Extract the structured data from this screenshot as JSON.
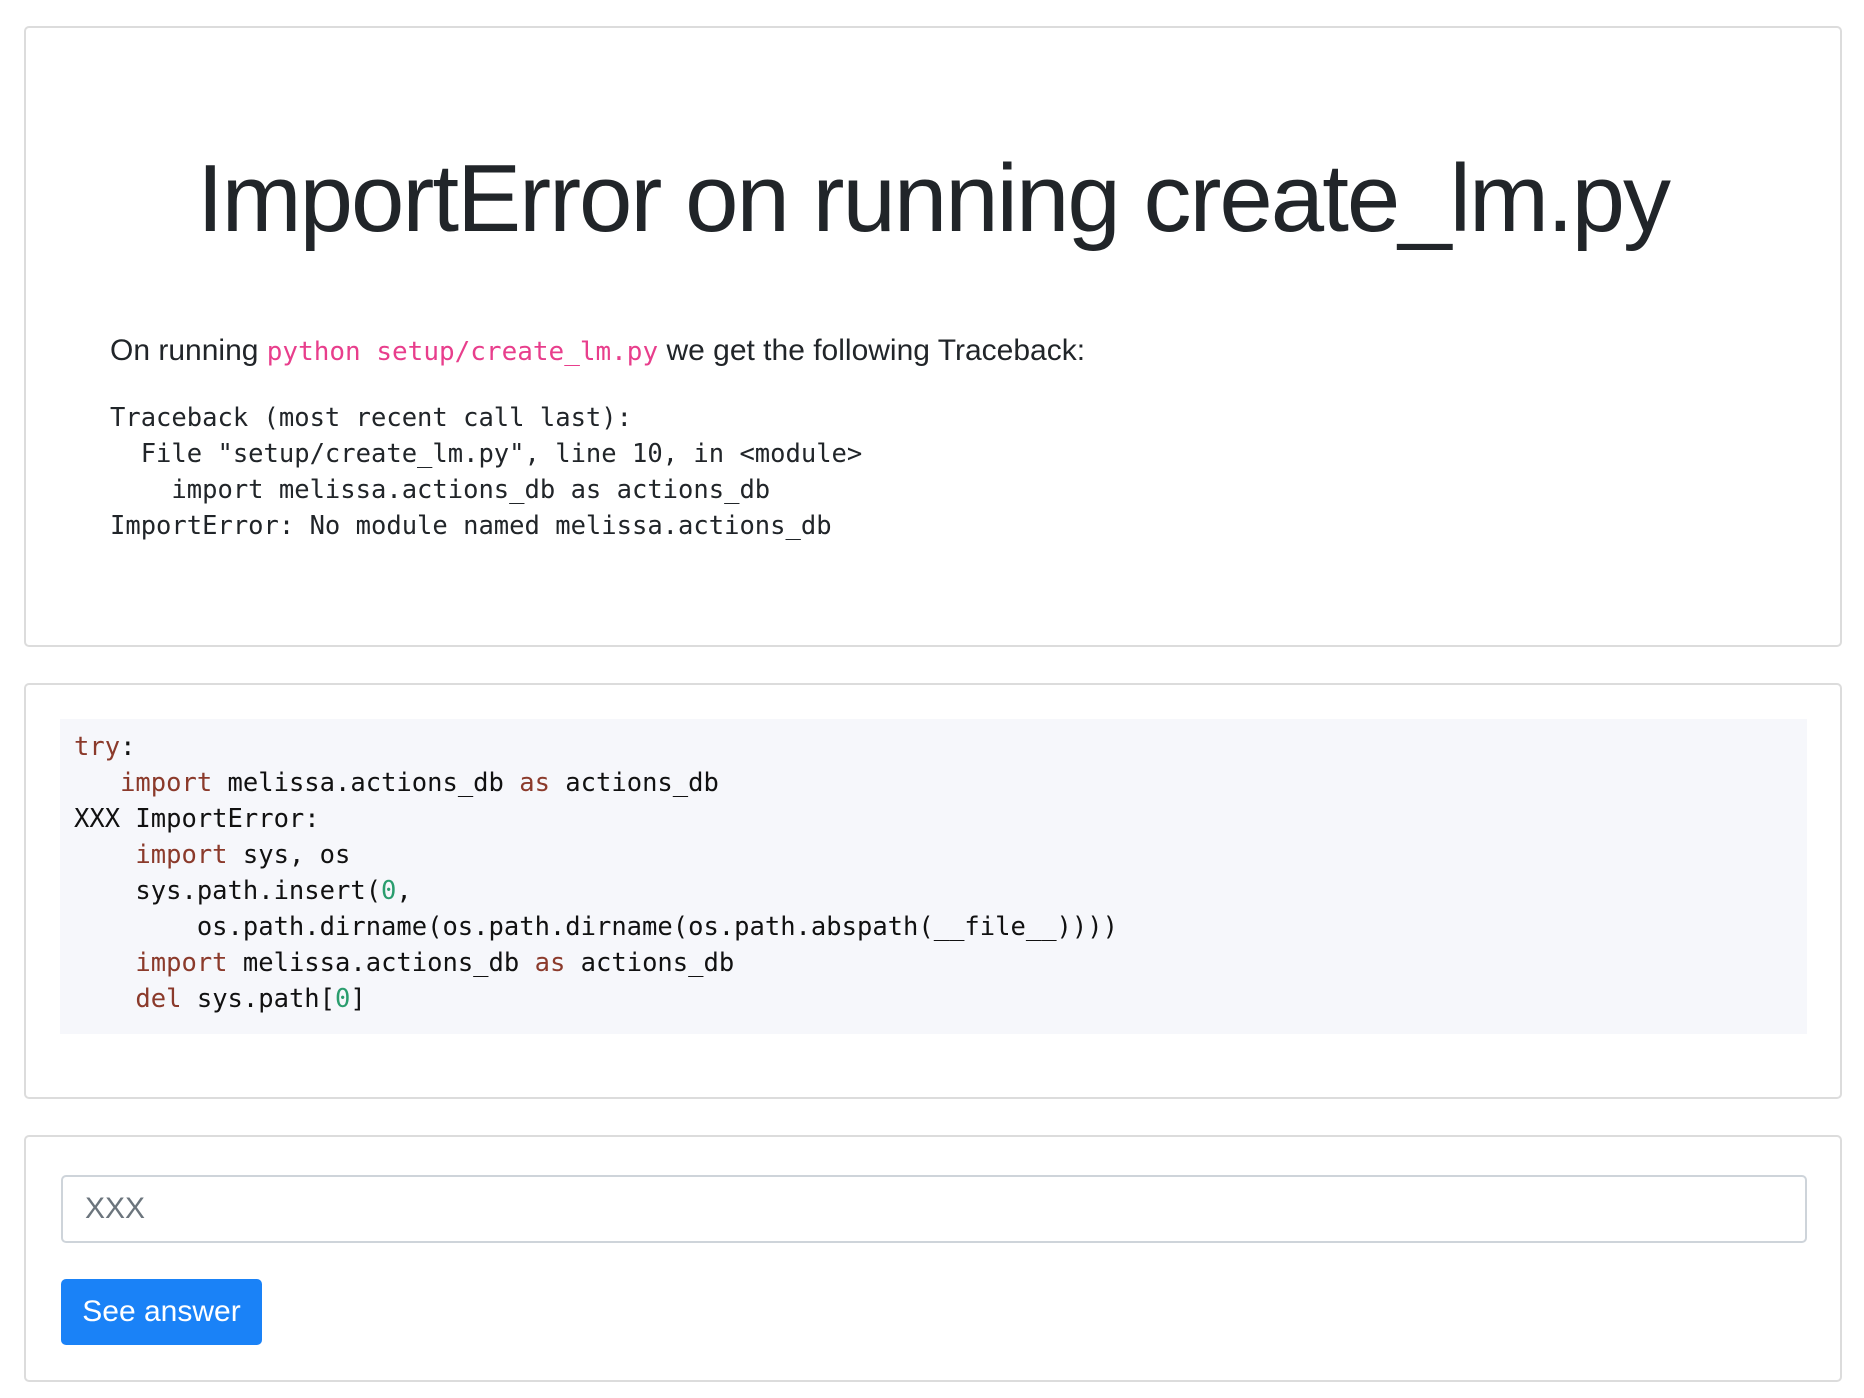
{
  "question": {
    "title": "ImportError on running create_lm.py",
    "intro_before": "On running ",
    "intro_code": "python setup/create_lm.py",
    "intro_after": " we get the following Traceback:",
    "traceback": [
      "Traceback (most recent call last):",
      "  File \"setup/create_lm.py\", line 10, in <module>",
      "    import melissa.actions_db as actions_db",
      "ImportError: No module named melissa.actions_db"
    ]
  },
  "code": {
    "lines": [
      [
        {
          "t": "try",
          "c": "kw"
        },
        {
          "t": ":",
          "c": ""
        }
      ],
      [
        {
          "t": "   ",
          "c": ""
        },
        {
          "t": "import",
          "c": "kw"
        },
        {
          "t": " melissa.actions_db ",
          "c": ""
        },
        {
          "t": "as",
          "c": "kw"
        },
        {
          "t": " actions_db",
          "c": ""
        }
      ],
      [
        {
          "t": "XXX ImportError:",
          "c": ""
        }
      ],
      [
        {
          "t": "    ",
          "c": ""
        },
        {
          "t": "import",
          "c": "kw"
        },
        {
          "t": " sys, os",
          "c": ""
        }
      ],
      [
        {
          "t": "    sys.path.insert(",
          "c": ""
        },
        {
          "t": "0",
          "c": "num"
        },
        {
          "t": ",",
          "c": ""
        }
      ],
      [
        {
          "t": "        os.path.dirname(os.path.dirname(os.path.abspath(__file__))))",
          "c": ""
        }
      ],
      [
        {
          "t": "    ",
          "c": ""
        },
        {
          "t": "import",
          "c": "kw"
        },
        {
          "t": " melissa.actions_db ",
          "c": ""
        },
        {
          "t": "as",
          "c": "kw"
        },
        {
          "t": " actions_db",
          "c": ""
        }
      ],
      [
        {
          "t": "    ",
          "c": ""
        },
        {
          "t": "del",
          "c": "kw"
        },
        {
          "t": " sys.path[",
          "c": ""
        },
        {
          "t": "0",
          "c": "num"
        },
        {
          "t": "]",
          "c": ""
        }
      ]
    ]
  },
  "answer": {
    "placeholder": "XXX",
    "value": "",
    "button_label": "See answer"
  },
  "colors": {
    "keyword": "#8b3a2b",
    "number": "#2a9d6e",
    "inline_code": "#e83e8c",
    "button": "#1a82f7",
    "code_background": "#f6f7fb"
  }
}
